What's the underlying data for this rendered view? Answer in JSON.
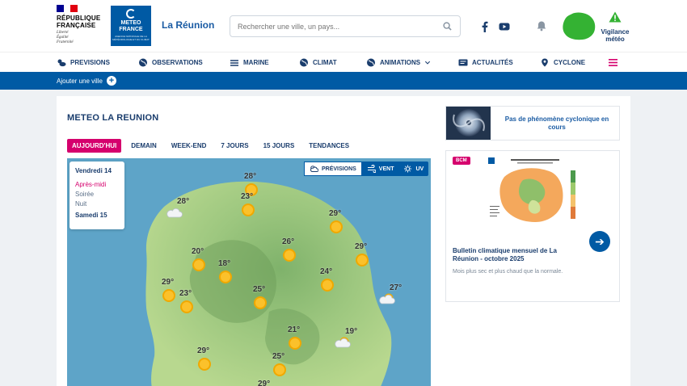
{
  "header": {
    "republic": [
      "RÉPUBLIQUE",
      "FRANÇAISE"
    ],
    "motto": [
      "Liberté",
      "Égalité",
      "Fraternité"
    ],
    "brand": [
      "METEO",
      "FRANCE"
    ],
    "brand_sub": "AGENCE NATIONALE DE LA MÉTÉOROLOGIE ET DU CLIMAT",
    "region": "La Réunion",
    "search_placeholder": "Rechercher une ville, un pays...",
    "vigilance": [
      "Vigilance",
      "météo"
    ],
    "colors": {
      "brand_blue": "#005aa4",
      "accent_pink": "#d5006d",
      "vigilance_green": "#34b233"
    }
  },
  "nav": {
    "items": [
      "PREVISIONS",
      "OBSERVATIONS",
      "MARINE",
      "CLIMAT",
      "ANIMATIONS",
      "ACTUALITÉS",
      "CYCLONE"
    ],
    "icons": [
      "weather-icon",
      "globe-icon",
      "waves-icon",
      "globe-icon",
      "globe-icon",
      "news-icon",
      "pin-icon"
    ]
  },
  "subbar": {
    "add_city": "Ajouter une ville"
  },
  "main": {
    "title": "METEO LA REUNION",
    "tabs": [
      "AUJOURD'HUI",
      "DEMAIN",
      "WEEK-END",
      "7 JOURS",
      "15 JOURS",
      "TENDANCES"
    ],
    "active_tab": 0,
    "day_panel": {
      "day": "Vendredi 14",
      "periods": [
        "Après-midi",
        "Soirée",
        "Nuit"
      ],
      "active_period": 0,
      "next_day": "Samedi 15"
    },
    "layers": [
      "PRÉVISIONS",
      "VENT",
      "UV"
    ],
    "active_layer": 0,
    "map_points": [
      {
        "temp": "28°",
        "icon": "sun"
      },
      {
        "temp": "23°",
        "icon": "sun"
      },
      {
        "temp": "28°",
        "icon": "cloud"
      },
      {
        "temp": "29°",
        "icon": "sun"
      },
      {
        "temp": "26°",
        "icon": "sun"
      },
      {
        "temp": "29°",
        "icon": "sun"
      },
      {
        "temp": "20°",
        "icon": "sun"
      },
      {
        "temp": "18°",
        "icon": "sun"
      },
      {
        "temp": "24°",
        "icon": "sun"
      },
      {
        "temp": "29°",
        "icon": "sun"
      },
      {
        "temp": "23°",
        "icon": "sun"
      },
      {
        "temp": "25°",
        "icon": "sun"
      },
      {
        "temp": "27°",
        "icon": "partly-cloudy"
      },
      {
        "temp": "21°",
        "icon": "sun"
      },
      {
        "temp": "19°",
        "icon": "partly-cloudy"
      },
      {
        "temp": "29°",
        "icon": "sun"
      },
      {
        "temp": "25°",
        "icon": "sun"
      },
      {
        "temp": "29°",
        "icon": "sun"
      }
    ]
  },
  "side": {
    "cyclone_text": "Pas de phénomène cyclonique en cours",
    "bcm_badge": "BCM",
    "bcm_title": "Bulletin climatique mensuel de La Réunion - octobre 2025",
    "bcm_subtitle": "Mois plus sec et plus chaud que la normale."
  }
}
